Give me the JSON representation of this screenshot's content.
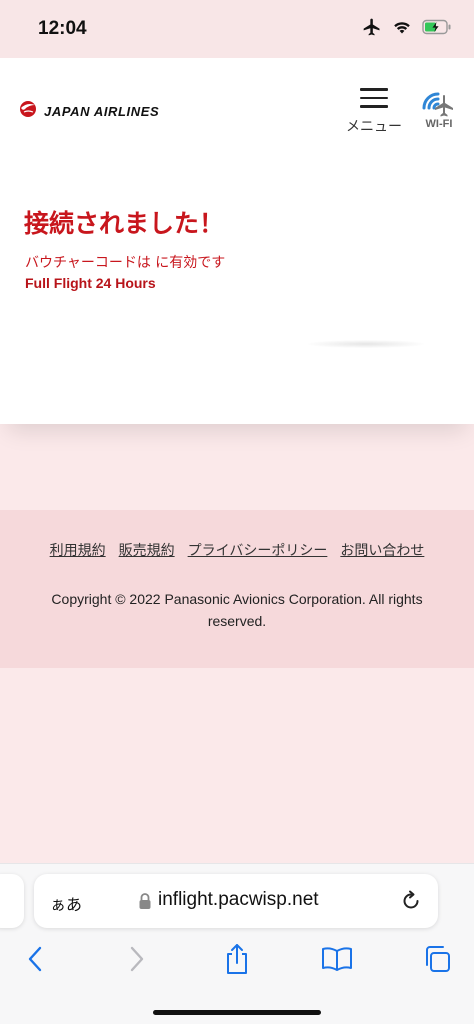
{
  "status_bar": {
    "time": "12:04",
    "icons": [
      "airplane-icon",
      "wifi-icon",
      "battery-charging-icon"
    ]
  },
  "header": {
    "brand": "JAPAN AIRLINES",
    "menu_label": "メニュー",
    "wifi_label": "WI-FI"
  },
  "main": {
    "title": "接続されました！",
    "voucher_text": "バウチャーコードは に有効です",
    "plan_name": "Full Flight 24 Hours"
  },
  "footer": {
    "links": [
      "利用規約",
      "販売規約",
      "プライバシーポリシー",
      "お問い合わせ"
    ],
    "copyright": "Copyright © 2022 Panasonic Avionics Corporation. All rights reserved."
  },
  "browser": {
    "aa_label": "ぁあ",
    "url": "inflight.pacwisp.net"
  },
  "colors": {
    "accent_red": "#c8161d",
    "page_background": "#fbe9ea",
    "footer_background": "#f6d9db",
    "ios_blue": "#1a73e8"
  }
}
